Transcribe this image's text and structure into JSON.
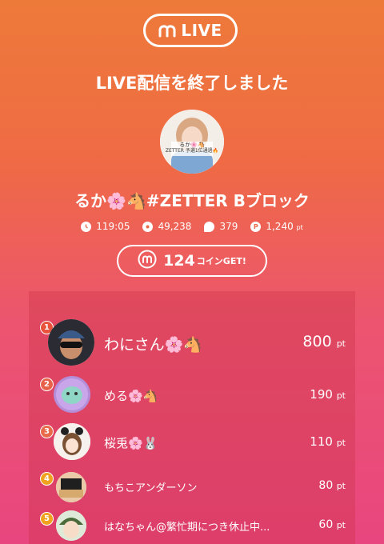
{
  "header": {
    "logo_text": "LIVE"
  },
  "title": "LIVE配信を終了しました",
  "streamer": {
    "avatar_caption_1": "るか🌸🐴",
    "avatar_caption_2": "ZETTER 予選1位通過🔥",
    "stream_title": "るか🌸🐴#ZETTER Bブロック"
  },
  "stats": {
    "duration": "119:05",
    "viewers": "49,238",
    "comments": "379",
    "points": "1,240",
    "points_unit": "pt"
  },
  "coin": {
    "amount": "124",
    "label": "コインGET!"
  },
  "ranking": [
    {
      "rank": "1",
      "name": "わにさん🌸🐴",
      "score": "800",
      "unit": "pt",
      "badge_color": "#e8513a"
    },
    {
      "rank": "2",
      "name": "める🌸🐴",
      "score": "190",
      "unit": "pt",
      "badge_color": "#e8624a"
    },
    {
      "rank": "3",
      "name": "桜兎🌸🐰",
      "score": "110",
      "unit": "pt",
      "badge_color": "#e86a4a"
    },
    {
      "rank": "4",
      "name": "もちこアンダーソン",
      "score": "80",
      "unit": "pt",
      "badge_color": "#f0a21e"
    },
    {
      "rank": "5",
      "name": "はなちゃん@繁忙期につき休止中...",
      "score": "60",
      "unit": "pt",
      "badge_color": "#f0a21e"
    }
  ]
}
